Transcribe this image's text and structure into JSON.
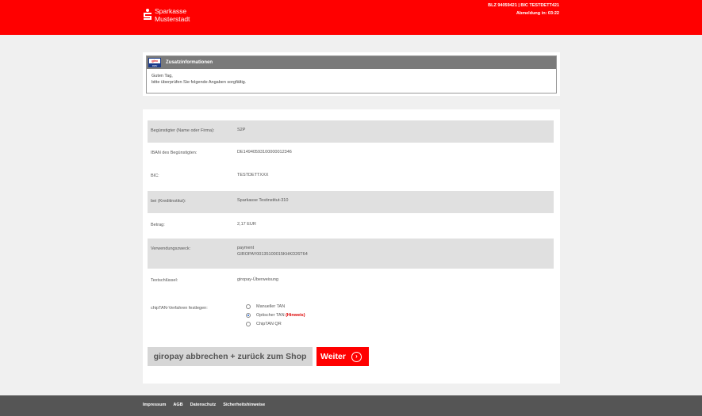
{
  "header": {
    "bank_name_line1": "Sparkasse",
    "bank_name_line2": "Musterstadt",
    "blz_bic": "BLZ 94059421 | BIC TESTDETT421",
    "logout_timer": "Abmeldung in: 03:22"
  },
  "info": {
    "logo_top": "giro",
    "logo_bottom": "pay",
    "title": "Zusatzinformationen",
    "greeting": "Guten Tag,",
    "message": "bitte überprüfen Sie folgende Angaben sorgfältig."
  },
  "payment": {
    "rows": [
      {
        "label": "Begünstigter (Name oder Firma):",
        "value": "S2P"
      },
      {
        "label": "IBAN des Begünstigten:",
        "value": "DE14940593100000012346"
      },
      {
        "label": "BIC:",
        "value": "TESTDETTXXX"
      },
      {
        "label": "bei (Kreditinstitut):",
        "value": "Sparkasse Testinstitut-310"
      },
      {
        "label": "Betrag:",
        "value": "2,17 EUR"
      },
      {
        "label": "Verwendungszweck:",
        "value": "payment",
        "value2": "GIROPAY00135100015KHKD26T64"
      },
      {
        "label": "Textschlüssel:",
        "value": "giropay-Überweisung"
      }
    ],
    "tan_label": "chipTAN-Verfahren festlegen:",
    "tan_options": [
      {
        "label": "Manueller TAN",
        "selected": false
      },
      {
        "label": "Optischer TAN",
        "hint": "(Hinweis)",
        "selected": true
      },
      {
        "label": "ChipTAN QR",
        "selected": false
      }
    ]
  },
  "buttons": {
    "cancel_label": "giropay abbrechen + zurück zum Shop",
    "next_label": "Weiter",
    "next_icon": "›"
  },
  "footer": {
    "links": [
      "Impressum",
      "AGB",
      "Datenschutz",
      "Sicherheitshinweise"
    ]
  },
  "colors": {
    "brand_red": "#ff0000",
    "footer_gray": "#555555",
    "giropay_blue": "#1a3a8a"
  }
}
